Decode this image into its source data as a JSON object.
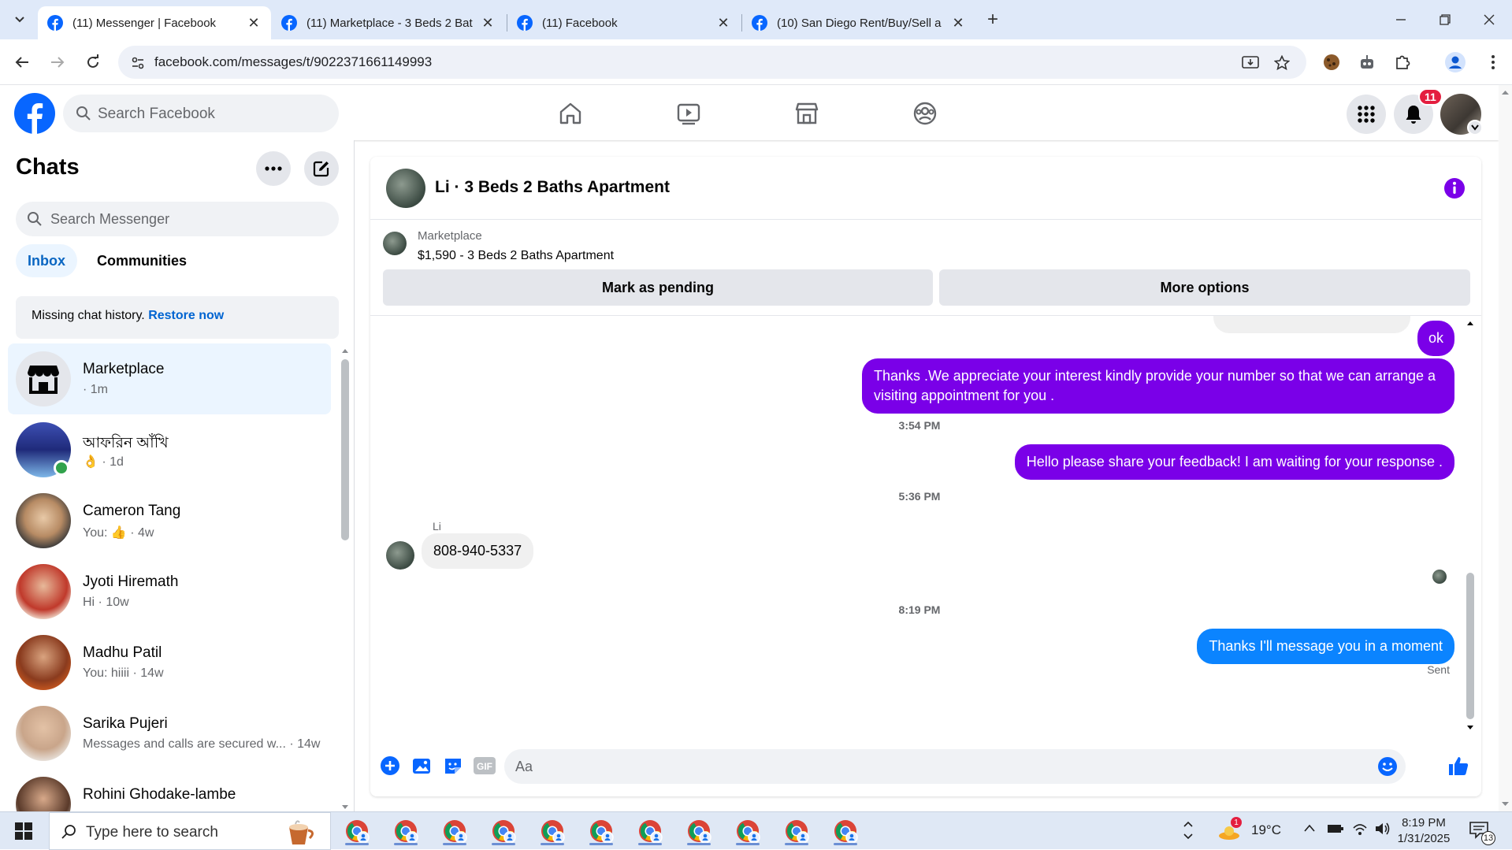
{
  "browser": {
    "tabs": [
      {
        "title": "(11) Messenger | Facebook",
        "active": true
      },
      {
        "title": "(11) Marketplace - 3 Beds 2 Bat",
        "active": false
      },
      {
        "title": "(11) Facebook",
        "active": false
      },
      {
        "title": "(10) San Diego Rent/Buy/Sell a",
        "active": false
      }
    ],
    "url": "facebook.com/messages/t/9022371661149993"
  },
  "facebook": {
    "search_placeholder": "Search Facebook",
    "notification_count": "11"
  },
  "sidebar": {
    "title": "Chats",
    "search_placeholder": "Search Messenger",
    "filters": [
      "Inbox",
      "Communities"
    ],
    "missing_text": "Missing chat history.",
    "restore_link": "Restore now",
    "chats": [
      {
        "name": "Marketplace",
        "meta": "· 1m"
      },
      {
        "name": "আফরিন আঁখি",
        "meta": "👌 · 1d"
      },
      {
        "name": "Cameron Tang",
        "meta": "You: 👍 · 4w"
      },
      {
        "name": "Jyoti Hiremath",
        "meta": "Hi · 10w"
      },
      {
        "name": "Madhu Patil",
        "meta": "You: hiiii · 14w"
      },
      {
        "name": "Sarika Pujeri",
        "meta": "Messages and calls are secured w... · 14w"
      },
      {
        "name": "Rohini Ghodake-lambe",
        "meta": ""
      }
    ]
  },
  "conversation": {
    "title": "Li · 3 Beds 2 Baths Apartment",
    "marketplace_label": "Marketplace",
    "listing": "$1,590 - 3 Beds 2 Baths Apartment",
    "mark_pending": "Mark as pending",
    "more_options": "More options",
    "messages": {
      "ok": "ok",
      "thanks": "Thanks .We appreciate your interest kindly provide your number so that we can arrange a visiting appointment for you .",
      "ts1": "3:54 PM",
      "feedback": "Hello please share your feedback! I am waiting for your response .",
      "ts2": "5:36 PM",
      "sender": "Li",
      "phone": "808-940-5337",
      "ts3": "8:19 PM",
      "last": "Thanks I'll message you in a moment",
      "status": "Sent"
    },
    "composer_placeholder": "Aa"
  },
  "taskbar": {
    "search_placeholder": "Type here to search",
    "weather": "19°C",
    "weather_badge": "1",
    "time": "8:19 PM",
    "date": "1/31/2025",
    "notif_count": "13"
  },
  "colors": {
    "facebook_blue": "#0866ff",
    "messenger_purple": "#7a00e8",
    "message_blue": "#0b84ff"
  }
}
